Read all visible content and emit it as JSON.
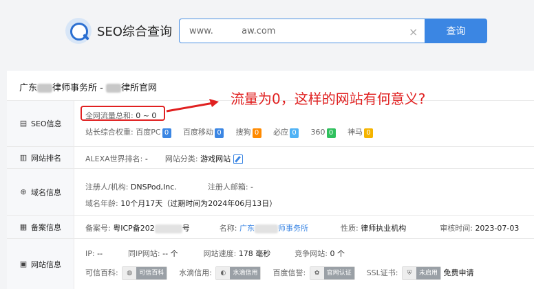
{
  "header": {
    "logo_text": "SEO综合查询",
    "search_value": "www.          aw.com",
    "clear_icon": "×",
    "search_button": "查询"
  },
  "site_title": {
    "prefix": "广东",
    "middle": "律师事务所 -",
    "suffix": "律所官网"
  },
  "annotation": {
    "text": "流量为0，这样的网站有何意义?"
  },
  "seo": {
    "head": "SEO信息",
    "traffic_label": "全网流量总和:",
    "traffic_value": "0 ~ 0",
    "weight_label": "站长综合权重:",
    "weights": [
      {
        "name": "百度PC",
        "value": "0",
        "color": "#3b86e3"
      },
      {
        "name": "百度移动",
        "value": "0",
        "color": "#3b86e3"
      },
      {
        "name": "搜狗",
        "value": "0",
        "color": "#ff8a00"
      },
      {
        "name": "必应",
        "value": "0",
        "color": "#4fb2f5"
      },
      {
        "name": "360",
        "value": "0",
        "color": "#2fc05d"
      },
      {
        "name": "神马",
        "value": "0",
        "color": "#f5b400"
      }
    ]
  },
  "rank": {
    "head": "网站排名",
    "alexa_label": "ALEXA世界排名:",
    "alexa_value": "-",
    "category_label": "网站分类:",
    "category_value": "游戏网站"
  },
  "domain": {
    "head": "域名信息",
    "registrar_label": "注册人/机构:",
    "registrar_value": "DNSPod,Inc.",
    "email_label": "注册人邮箱:",
    "email_value": "-",
    "age_label": "域名年龄:",
    "age_value": "10个月17天（过期时间为2024年06月13日）"
  },
  "icp": {
    "head": "备案信息",
    "no_label": "备案号:",
    "no_value_a": "粤ICP备202",
    "no_value_b": "号",
    "name_label": "名称:",
    "name_value_a": "广东",
    "name_value_b": "师事务所",
    "nature_label": "性质:",
    "nature_value": "律师执业机构",
    "review_label": "审核时间:",
    "review_value": "2023-07-03"
  },
  "siteinfo": {
    "head": "网站信息",
    "ip_label": "IP:",
    "ip_value": "--",
    "same_ip_label": "同IP网站:",
    "same_ip_value": "-- 个",
    "speed_label": "网站速度:",
    "speed_value": "178 毫秒",
    "compete_label": "竞争网站:",
    "compete_value": "0 个",
    "wiki_label": "可信百科:",
    "wiki_badge": "可信百科",
    "shuidi_label": "水滴信用:",
    "shuidi_badge": "水滴信用",
    "baidu_label": "百度信誉:",
    "baidu_badge": "官网认证",
    "ssl_label": "SSL证书:",
    "ssl_badge": "未启用",
    "ssl_apply": "免费申请"
  }
}
